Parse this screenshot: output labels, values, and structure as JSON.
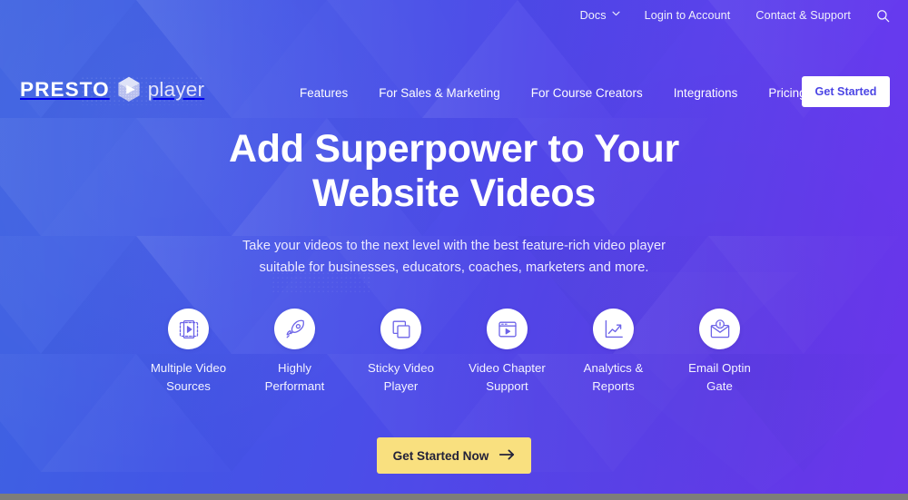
{
  "brand": {
    "name_bold": "PRESTO",
    "name_light": "player",
    "logo_icon": "presto-play-hexagon-icon"
  },
  "topbar": {
    "items": [
      {
        "label": "Docs",
        "has_caret": true,
        "icon": "chevron-down-icon"
      },
      {
        "label": "Login to Account",
        "has_caret": false
      },
      {
        "label": "Contact & Support",
        "has_caret": false
      }
    ],
    "search_icon": "search-icon"
  },
  "nav": {
    "items": [
      {
        "label": "Features"
      },
      {
        "label": "For Sales & Marketing"
      },
      {
        "label": "For Course Creators"
      },
      {
        "label": "Integrations"
      },
      {
        "label": "Pricing"
      }
    ],
    "cta_label": "Get Started"
  },
  "hero": {
    "heading_line1": "Add Superpower to Your",
    "heading_line2": "Website Videos",
    "sub_line1": "Take your videos to the next level with the best feature-rich video player",
    "sub_line2": "suitable for businesses, educators, coaches, marketers and more."
  },
  "features": [
    {
      "label_line1": "Multiple Video",
      "label_line2": "Sources",
      "icon": "video-layers-icon"
    },
    {
      "label_line1": "Highly",
      "label_line2": "Performant",
      "icon": "rocket-icon"
    },
    {
      "label_line1": "Sticky Video",
      "label_line2": "Player",
      "icon": "stacked-windows-icon"
    },
    {
      "label_line1": "Video Chapter",
      "label_line2": "Support",
      "icon": "video-chapters-icon"
    },
    {
      "label_line1": "Analytics &",
      "label_line2": "Reports",
      "icon": "line-chart-up-icon"
    },
    {
      "label_line1": "Email Optin",
      "label_line2": "Gate",
      "icon": "envelope-lock-icon"
    }
  ],
  "cta": {
    "label": "Get Started Now",
    "icon": "arrow-right-icon"
  },
  "colors": {
    "gradient_start": "#3f63e0",
    "gradient_end": "#6c36ef",
    "accent_yellow": "#f9e07f",
    "brand_purple": "#4b45e4",
    "icon_stroke": "#6c63e8",
    "white": "#ffffff"
  }
}
